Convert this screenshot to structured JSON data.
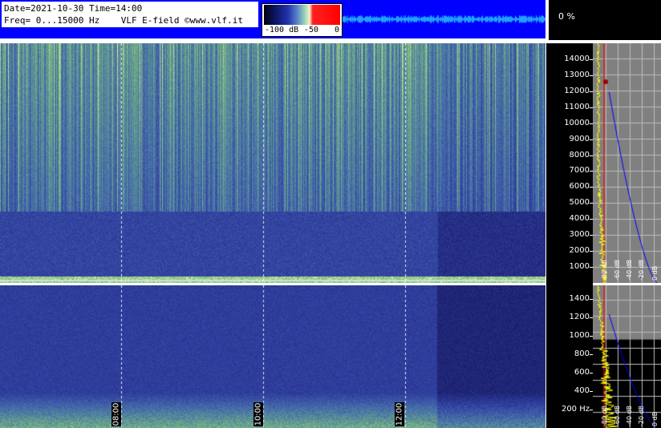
{
  "header": {
    "date_line": "Date=2021-10-30 Time=14:00",
    "freq_line": "Freq= 0...15000 Hz    VLF E-field ©www.vlf.it",
    "percent": "0 %"
  },
  "colorbar": {
    "labels": [
      "-100 dB",
      "-50",
      "0"
    ]
  },
  "upper_axis": {
    "labels": [
      "14000",
      "13000",
      "12000",
      "11000",
      "10000",
      "9000",
      "8000",
      "7000",
      "6000",
      "5000",
      "4000",
      "3000",
      "2000",
      "1000"
    ],
    "max_hz": 15000
  },
  "lower_axis": {
    "labels": [
      "1400",
      "1200",
      "1000",
      "800",
      "600",
      "400",
      "200 Hz"
    ],
    "max_hz": 1550
  },
  "time_labels": [
    "08:00",
    "10:00",
    "12:00"
  ],
  "profile_db_labels": [
    "0 dB",
    "-20 dB",
    "-40 dB",
    "-60 dB",
    "-80 dB"
  ],
  "colors": {
    "header_bg": "#0000ff",
    "panel_bg": "#000000",
    "profile_bg": "#808080",
    "spectrum_trace": "#ffff00",
    "marker_trace": "#ff0000",
    "noise_curve": "#0000ff"
  },
  "icons": [
    "colorbar-gradient-icon",
    "spectrogram-image-icon",
    "spectrum-profile-icon"
  ]
}
